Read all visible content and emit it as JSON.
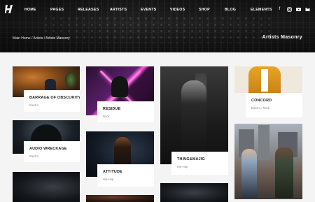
{
  "nav": {
    "items": [
      "Home",
      "Pages",
      "Releases",
      "Artists",
      "Events",
      "Videos",
      "Shop",
      "Blog",
      "Elements"
    ],
    "social_icons": [
      "facebook-icon",
      "instagram-icon",
      "youtube-icon",
      "bandcamp-icon"
    ]
  },
  "hero": {
    "breadcrumb": "Main Home / Artists / Artists Masonry",
    "title": "Artists Masonry"
  },
  "artists": [
    {
      "name": "Barrage of Obscurity",
      "genre": "Electro"
    },
    {
      "name": "Residue",
      "genre": "Rock"
    },
    {
      "name": "Thing&Majig",
      "genre": "Hip-Hop"
    },
    {
      "name": "Concord",
      "genre": "Electro / Rock"
    },
    {
      "name": "Audio Wreckage",
      "genre": "Electro"
    },
    {
      "name": "Attitude",
      "genre": "Hip-Hop"
    }
  ]
}
